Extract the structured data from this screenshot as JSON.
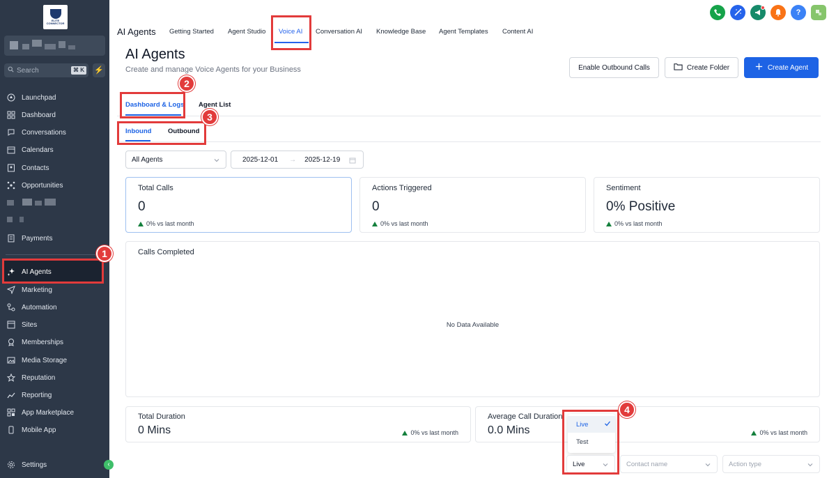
{
  "sidebar": {
    "search_placeholder": "Search",
    "search_shortcut": "⌘ K",
    "items": [
      {
        "label": "Launchpad",
        "icon": "rocket-icon"
      },
      {
        "label": "Dashboard",
        "icon": "grid-icon"
      },
      {
        "label": "Conversations",
        "icon": "chat-bubble-icon"
      },
      {
        "label": "Calendars",
        "icon": "calendar-icon"
      },
      {
        "label": "Contacts",
        "icon": "contact-card-icon"
      },
      {
        "label": "Opportunities",
        "icon": "network-icon"
      },
      {
        "label": "Payments",
        "icon": "receipt-icon"
      },
      {
        "label": "AI Agents",
        "icon": "sparkle-icon"
      },
      {
        "label": "Marketing",
        "icon": "send-icon"
      },
      {
        "label": "Automation",
        "icon": "workflow-icon"
      },
      {
        "label": "Sites",
        "icon": "browser-icon"
      },
      {
        "label": "Memberships",
        "icon": "badge-icon"
      },
      {
        "label": "Media Storage",
        "icon": "image-icon"
      },
      {
        "label": "Reputation",
        "icon": "star-icon"
      },
      {
        "label": "Reporting",
        "icon": "trend-icon"
      },
      {
        "label": "App Marketplace",
        "icon": "apps-icon"
      },
      {
        "label": "Mobile App",
        "icon": "phone-icon"
      }
    ],
    "settings_label": "Settings"
  },
  "topbar": {
    "app_title": "AI Agents",
    "tabs": [
      "Getting Started",
      "Agent Studio",
      "Voice AI",
      "Conversation AI",
      "Knowledge Base",
      "Agent Templates",
      "Content AI"
    ],
    "active_tab": "Voice AI"
  },
  "header": {
    "title": "AI Agents",
    "subtitle": "Create and manage Voice Agents for your Business",
    "enable_outbound_label": "Enable Outbound Calls",
    "create_folder_label": "Create Folder",
    "create_agent_label": "Create Agent"
  },
  "subtabs": {
    "dashboard": "Dashboard & Logs",
    "agent_list": "Agent List"
  },
  "direction_tabs": {
    "inbound": "Inbound",
    "outbound": "Outbound"
  },
  "filters": {
    "agent_select": "All Agents",
    "date_start": "2025-12-01",
    "date_end": "2025-12-19"
  },
  "metrics": {
    "total_calls": {
      "label": "Total Calls",
      "value": "0",
      "delta": "0% vs last month"
    },
    "actions": {
      "label": "Actions Triggered",
      "value": "0",
      "delta": "0% vs last month"
    },
    "sentiment": {
      "label": "Sentiment",
      "value": "0% Positive",
      "delta": "0% vs last month"
    }
  },
  "calls_completed": {
    "label": "Calls Completed",
    "empty": "No Data Available"
  },
  "duration": {
    "total": {
      "label": "Total Duration",
      "value": "0 Mins",
      "delta": "0% vs last month"
    },
    "average": {
      "label": "Average Call Duration",
      "value": "0.0 Mins",
      "delta": "0% vs last month"
    }
  },
  "mode_dropdown": {
    "options": [
      "Live",
      "Test"
    ],
    "selected": "Live"
  },
  "log_filters": {
    "contact_placeholder": "Contact name",
    "action_placeholder": "Action type"
  },
  "annotations": [
    "1",
    "2",
    "3",
    "4"
  ],
  "colors": {
    "accent": "#1d63e5",
    "annotation": "#e23b3b",
    "sidebar": "#2d3848",
    "positive": "#15803d"
  }
}
